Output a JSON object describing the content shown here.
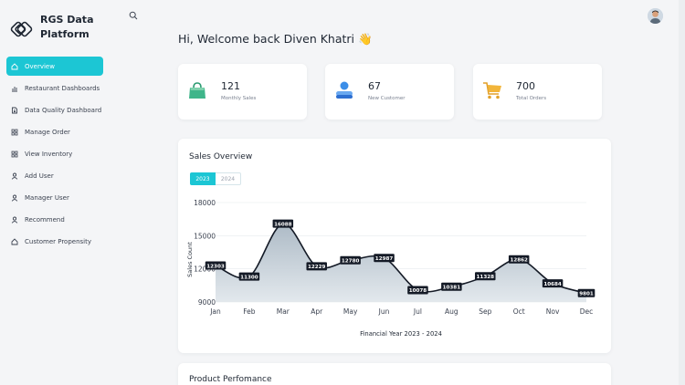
{
  "brand": {
    "name": "RGS Data Platform"
  },
  "sidebar": {
    "items": [
      {
        "label": "Overview",
        "icon": "home-icon",
        "active": true
      },
      {
        "label": "Restaurant Dashboards",
        "icon": "bar-chart-icon"
      },
      {
        "label": "Data Quality Dashboard",
        "icon": "document-icon"
      },
      {
        "label": "Manage Order",
        "icon": "grid-icon"
      },
      {
        "label": "View Inventory",
        "icon": "grid-icon"
      },
      {
        "label": "Add User",
        "icon": "user-icon"
      },
      {
        "label": "Manager User",
        "icon": "user-icon"
      },
      {
        "label": "Recommend",
        "icon": "user-icon"
      },
      {
        "label": "Customer Propensity",
        "icon": "home-icon"
      }
    ]
  },
  "header": {
    "welcome": "Hi, Welcome back Diven Khatri 👋"
  },
  "stats": [
    {
      "value": "121",
      "label": "Monthly Sales",
      "icon": "shopping-bag-icon",
      "color": "#3fb58a"
    },
    {
      "value": "67",
      "label": "New Customer",
      "icon": "customers-icon",
      "color": "#3b8ee8"
    },
    {
      "value": "700",
      "label": "Total Orders",
      "icon": "cart-icon",
      "color": "#f2b53a"
    }
  ],
  "sales_overview": {
    "title": "Sales Overview",
    "tabs": [
      "2023",
      "2024"
    ],
    "active_tab": "2023"
  },
  "product_performance": {
    "title": "Product Perfomance"
  },
  "colors": {
    "accent": "#1cc6d4",
    "line": "#141a26",
    "area": "#c3cfd8"
  },
  "chart_data": {
    "type": "area",
    "categories": [
      "Jan",
      "Feb",
      "Mar",
      "Apr",
      "May",
      "Jun",
      "Jul",
      "Aug",
      "Sep",
      "Oct",
      "Nov",
      "Dec"
    ],
    "values": [
      12303,
      11300,
      16088,
      12229,
      12780,
      12987,
      10078,
      10381,
      11328,
      12862,
      10684,
      9801
    ],
    "xlabel": "Financial Year 2023 - 2024",
    "ylabel": "Sales Count",
    "yticks": [
      9000,
      12000,
      15000,
      18000
    ],
    "ytick_labels": [
      "9000",
      "12000",
      "15000",
      "18000"
    ],
    "ylim": [
      9000,
      18000
    ],
    "grid": true
  }
}
